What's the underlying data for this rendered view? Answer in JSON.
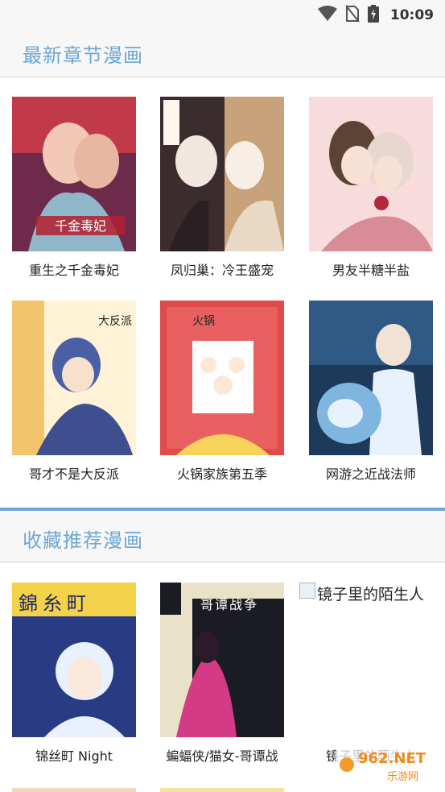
{
  "status_bar": {
    "time": "10:09",
    "icons": [
      "wifi-icon",
      "no-sim-icon",
      "battery-charging-icon"
    ]
  },
  "sections": {
    "latest": {
      "title": "最新章节漫画",
      "items": [
        {
          "title": "重生之千金毒妃",
          "palette": [
            "#c23a4a",
            "#6d2a4a",
            "#f2c8b6"
          ]
        },
        {
          "title": "凤归巢：冷王盛宠",
          "palette": [
            "#3b2c2e",
            "#c7a27a",
            "#f1e7de"
          ]
        },
        {
          "title": "男友半糖半盐",
          "palette": [
            "#f3c9cc",
            "#d88c98",
            "#fff3f1"
          ]
        },
        {
          "title": "哥才不是大反派",
          "palette": [
            "#4b5fa6",
            "#f2c46b",
            "#fff2d6"
          ]
        },
        {
          "title": "火锅家族第五季",
          "palette": [
            "#e24a4a",
            "#f6d35b",
            "#ffffff"
          ]
        },
        {
          "title": "网游之近战法师",
          "palette": [
            "#1e3a5a",
            "#7fb6e0",
            "#e8f2ff"
          ]
        }
      ]
    },
    "recommend": {
      "title": "收藏推荐漫画",
      "items": [
        {
          "title": "锦丝町 Night",
          "cover_text": "錦糸町",
          "palette": [
            "#2a3b86",
            "#f4d24a",
            "#e9f1ff"
          ]
        },
        {
          "title": "蝙蝠侠/猫女-哥谭战",
          "cover_text": "哥谭战争",
          "palette": [
            "#1b1b24",
            "#d43a86",
            "#e9e2c9"
          ]
        },
        {
          "title": "镜子里的陌生人",
          "broken_alt": "镜子里的陌生人"
        }
      ]
    }
  },
  "watermark": {
    "brand": "962.NET",
    "sub": "乐游网"
  }
}
